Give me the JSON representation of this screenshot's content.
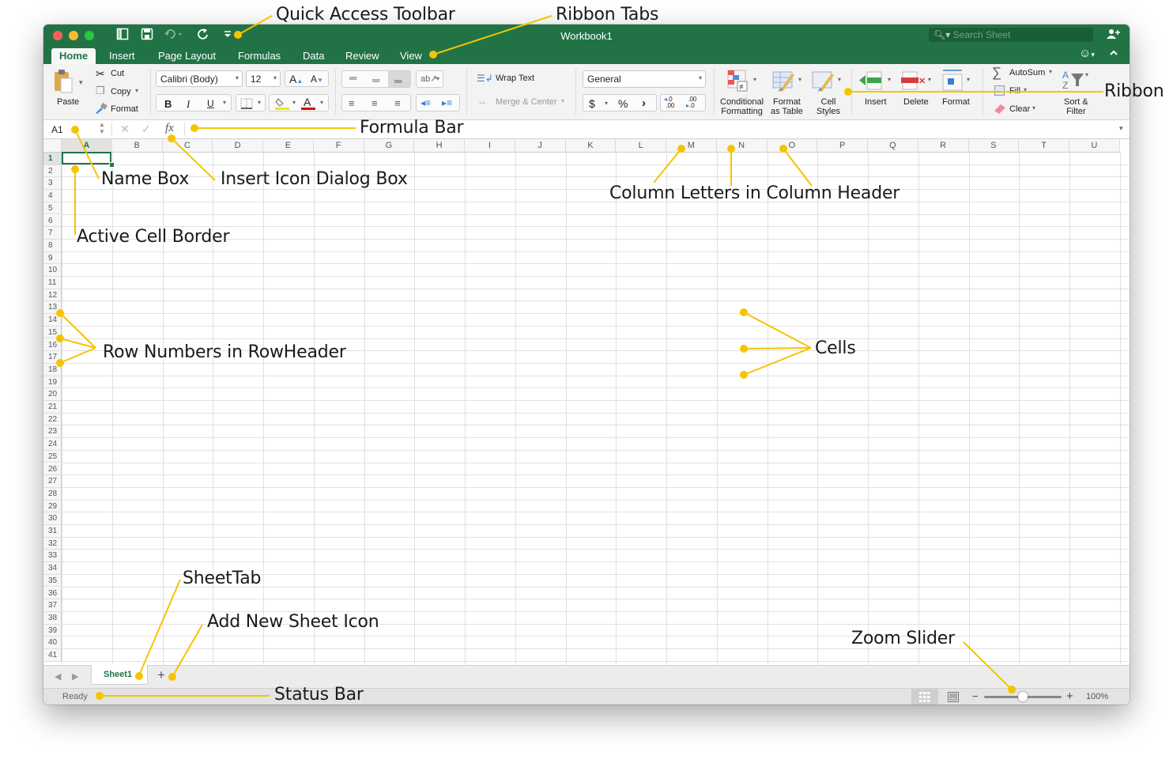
{
  "window": {
    "title": "Workbook1",
    "search_placeholder": "Search Sheet",
    "accent_color": "#217346"
  },
  "quick_access_toolbar": {
    "icons": [
      "sidebar-icon",
      "save-icon",
      "undo-icon",
      "redo-icon",
      "customize-icon"
    ]
  },
  "ribbon_tabs": [
    {
      "label": "Home",
      "active": true
    },
    {
      "label": "Insert"
    },
    {
      "label": "Page Layout"
    },
    {
      "label": "Formulas"
    },
    {
      "label": "Data"
    },
    {
      "label": "Review"
    },
    {
      "label": "View"
    }
  ],
  "ribbon": {
    "clipboard": {
      "paste": "Paste",
      "cut": "Cut",
      "copy": "Copy",
      "format": "Format"
    },
    "font": {
      "name": "Calibri (Body)",
      "size": "12",
      "bold": "B",
      "italic": "I",
      "underline": "U",
      "grow": "A",
      "shrink": "A",
      "font_color": "A"
    },
    "alignment": {
      "wrap_text": "Wrap Text",
      "merge_center": "Merge & Center"
    },
    "number": {
      "format": "General",
      "currency": "$",
      "percent": "%",
      "comma": "›",
      "inc_decimal": ".0 .00",
      "dec_decimal": ".00 .0"
    },
    "styles": {
      "conditional_1": "Conditional",
      "conditional_2": "Formatting",
      "format_table_1": "Format",
      "format_table_2": "as Table",
      "cell_styles_1": "Cell",
      "cell_styles_2": "Styles"
    },
    "cells": {
      "insert": "Insert",
      "delete": "Delete",
      "format": "Format"
    },
    "editing": {
      "autosum": "AutoSum",
      "fill": "Fill",
      "clear": "Clear",
      "sort_1": "Sort &",
      "sort_2": "Filter"
    }
  },
  "formula_bar": {
    "name_box": "A1",
    "fx": "fx",
    "value": ""
  },
  "grid": {
    "columns": [
      "A",
      "B",
      "C",
      "D",
      "E",
      "F",
      "G",
      "H",
      "I",
      "J",
      "K",
      "L",
      "M",
      "N",
      "O",
      "P",
      "Q",
      "R",
      "S",
      "T",
      "U"
    ],
    "rows": 41,
    "active_cell": "A1"
  },
  "sheets": {
    "tabs": [
      {
        "label": "Sheet1",
        "active": true
      }
    ],
    "add_label": "+"
  },
  "status_bar": {
    "status": "Ready",
    "zoom_label": "100%",
    "zoom_minus": "−",
    "zoom_plus": "+",
    "zoom_percent": 100
  },
  "annotations": {
    "color": "#f5c400",
    "quick_access_toolbar": "Quick Access Toolbar",
    "ribbon_tabs": "Ribbon Tabs",
    "ribbon": "Ribbon",
    "formula_bar": "Formula Bar",
    "name_box": "Name Box",
    "insert_icon_dialog_box": "Insert Icon Dialog Box",
    "column_letters": "Column Letters in Column Header",
    "active_cell_border": "Active Cell Border",
    "row_numbers": "Row Numbers in RowHeader",
    "cells": "Cells",
    "sheet_tab": "SheetTab",
    "add_new_sheet_icon": "Add New Sheet Icon",
    "zoom_slider": "Zoom Slider",
    "status_bar": "Status Bar"
  }
}
